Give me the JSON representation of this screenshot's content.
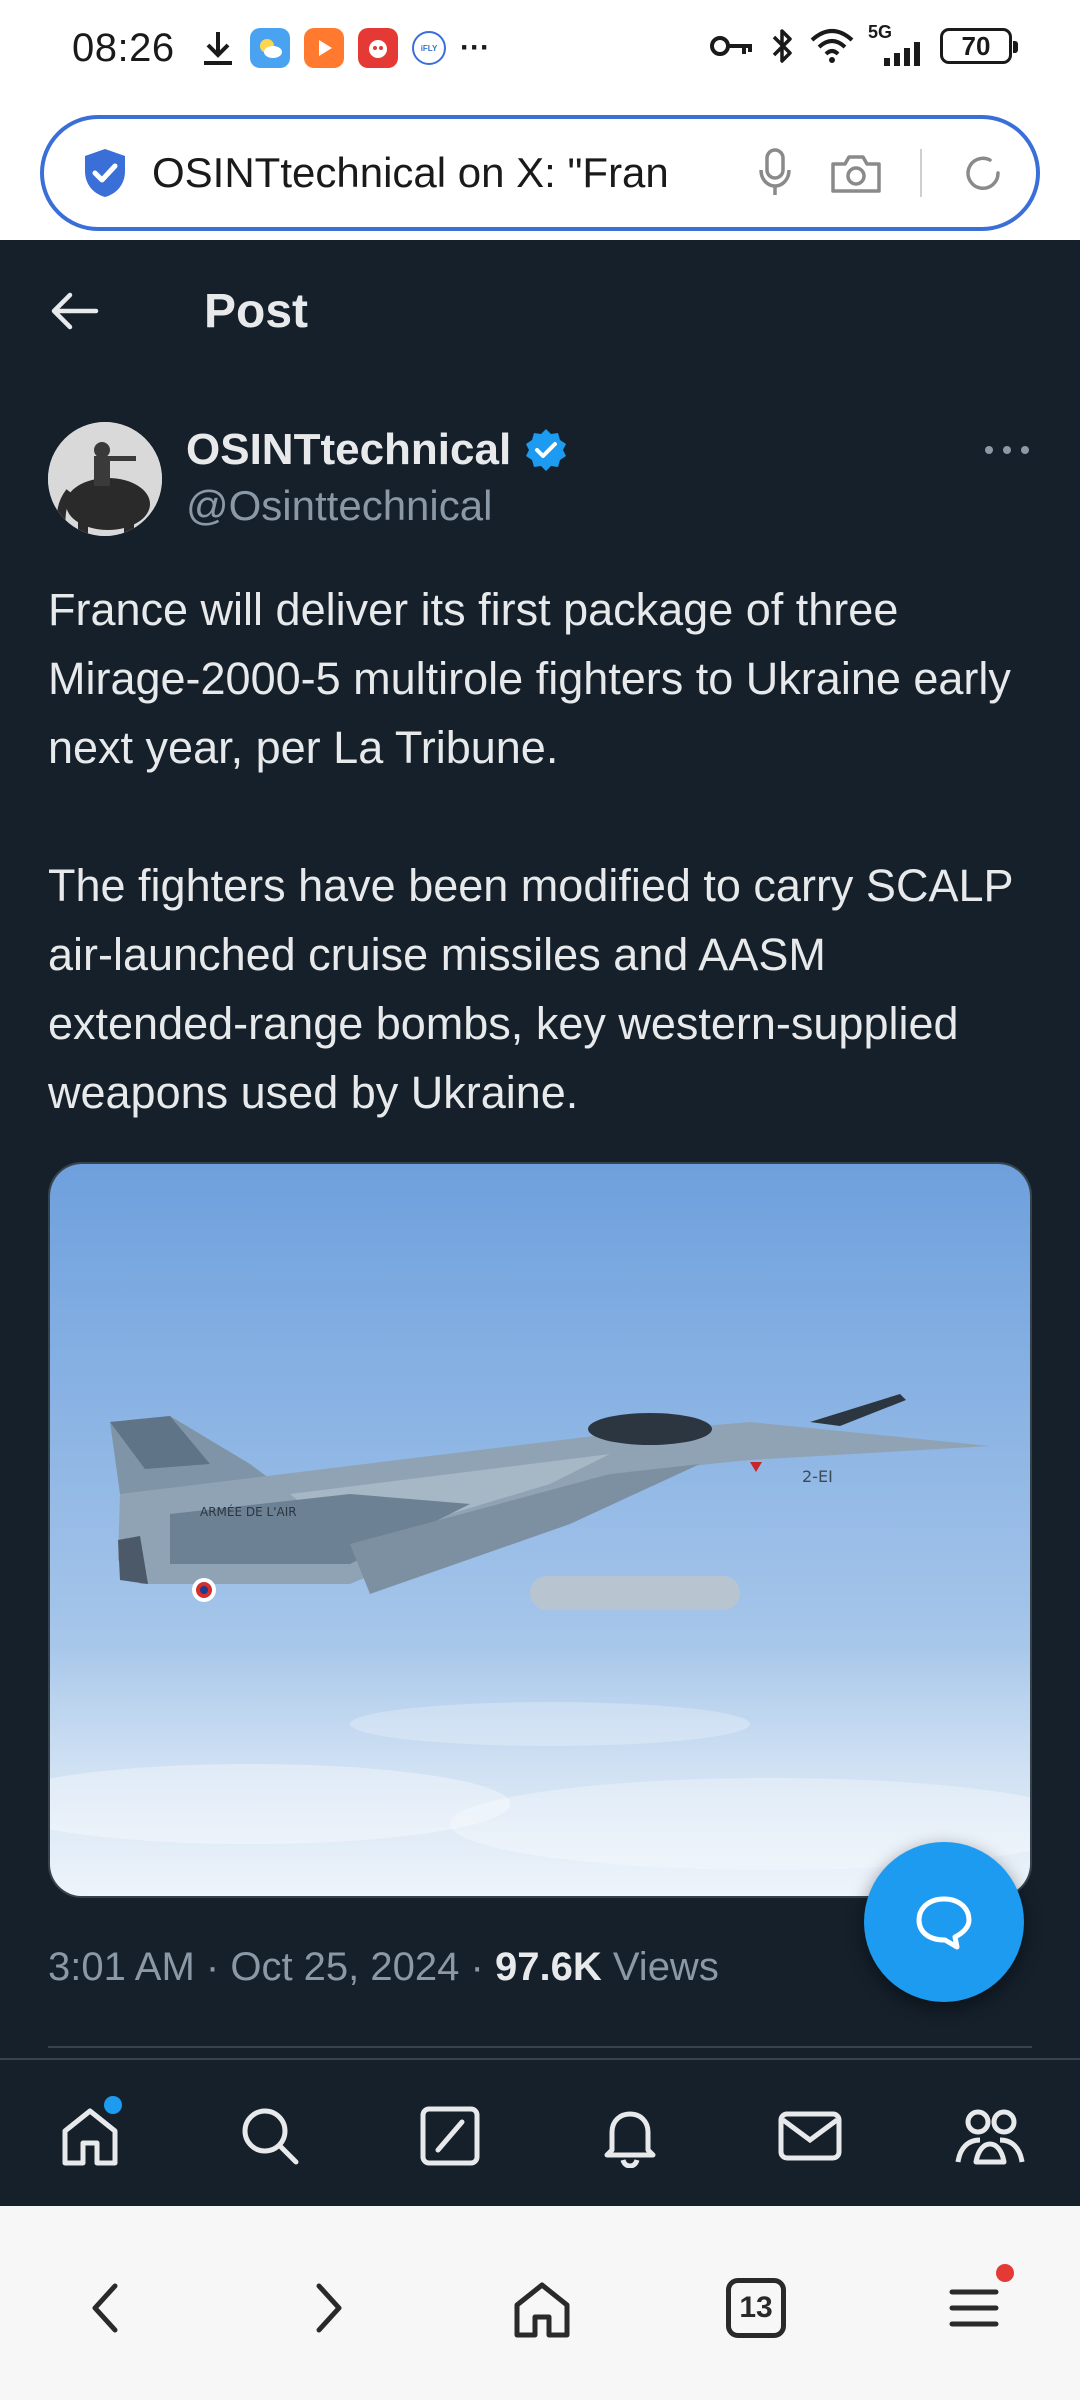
{
  "status_bar": {
    "time": "08:26",
    "network": "5G",
    "battery": "70",
    "overflow": "···"
  },
  "url_bar": {
    "text": "OSINTtechnical on X: \"Fran"
  },
  "header": {
    "title": "Post"
  },
  "author": {
    "name": "OSINTtechnical",
    "handle": "@Osinttechnical"
  },
  "post": {
    "paragraphs": [
      "France will deliver its first package of three Mirage-2000-5 multirole fighters to Ukraine early next year, per La Tribune.",
      "The fighters have been modified to carry SCALP air-launched cruise missiles and AASM extended-range bombs, key western-supplied weapons used by Ukraine."
    ],
    "time": "3:01 AM",
    "date": "Oct 25, 2024",
    "views_count": "97.6K",
    "views_label": "Views",
    "separator": "·"
  },
  "image": {
    "aircraft_text": "ARMÉE DE L'AIR",
    "tail_code": "2-EI"
  },
  "browser": {
    "tab_count": "13"
  },
  "colors": {
    "background": "#15202b",
    "accent": "#1d9bf0",
    "text": "#e7e9ea",
    "muted": "#8b98a5",
    "notification": "#e53935"
  }
}
